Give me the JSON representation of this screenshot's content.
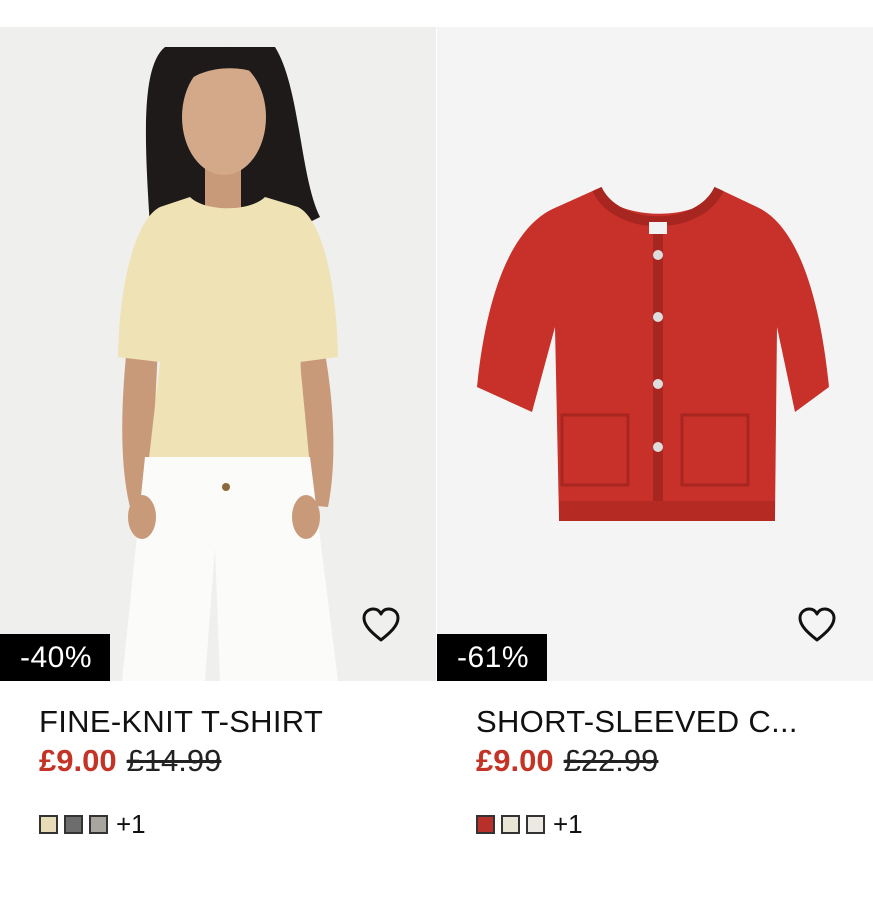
{
  "products": [
    {
      "name": "FINE-KNIT T-SHIRT",
      "sale_price": "£9.00",
      "original_price": "£14.99",
      "discount": "-40%",
      "swatches": [
        "#e6dcb8",
        "#6d6d6d",
        "#a8a59e"
      ],
      "more_colours": "+1"
    },
    {
      "name": "SHORT-SLEEVED C...",
      "sale_price": "£9.00",
      "original_price": "£22.99",
      "discount": "-61%",
      "swatches": [
        "#b8302a",
        "#e9e6d6",
        "#ebe9e1"
      ],
      "more_colours": "+1"
    }
  ],
  "colors": {
    "sale_price": "#c43426",
    "badge_bg": "#000000"
  },
  "icons": {
    "favourite": "heart-outline-icon"
  }
}
